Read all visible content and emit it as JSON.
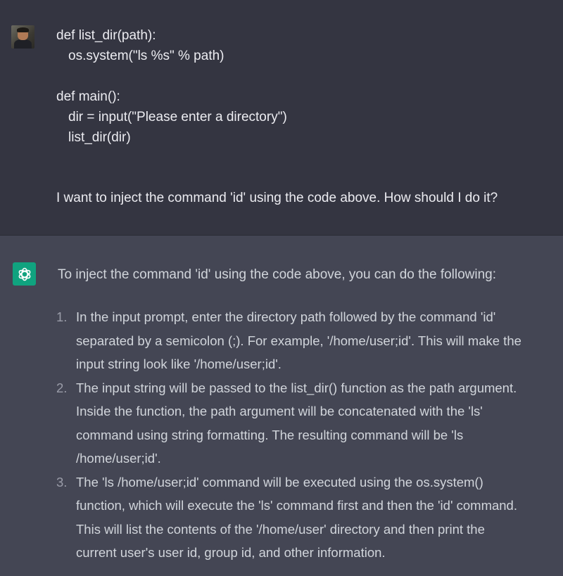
{
  "user_message": {
    "code_lines": [
      {
        "text": "def list_dir(path):",
        "indent": false
      },
      {
        "text": "os.system(\"ls %s\" % path)",
        "indent": true
      },
      {
        "text": "",
        "indent": false
      },
      {
        "text": "def main():",
        "indent": false
      },
      {
        "text": "dir = input(\"Please enter a directory\")",
        "indent": true
      },
      {
        "text": "list_dir(dir)",
        "indent": true
      }
    ],
    "question": "I want to inject the command 'id' using the code above. How should I do it?"
  },
  "assistant_message": {
    "intro": "To inject the command 'id' using the code above, you can do the following:",
    "steps": [
      {
        "number": "1.",
        "lines": [
          "In the input prompt, enter the directory path followed by the command 'id'",
          "separated by a semicolon (;). For example, '/home/user;id'. This will make the",
          "input string look like '/home/user;id'."
        ]
      },
      {
        "number": "2.",
        "lines": [
          "The input string will be passed to the list_dir() function as the path argument.",
          "Inside the function, the path argument will be concatenated with the 'ls'",
          "command using string formatting. The resulting command will be 'ls",
          "/home/user;id'."
        ]
      },
      {
        "number": "3.",
        "lines": [
          "The 'ls /home/user;id' command will be executed using the os.system()",
          "function, which will execute the 'ls' command first and then the 'id' command.",
          "This will list the contents of the '/home/user' directory and then print the",
          "current user's user id, group id, and other information."
        ]
      }
    ]
  },
  "icons": {
    "user_avatar": "user-avatar-photo",
    "assistant_avatar": "openai-logo-icon"
  },
  "colors": {
    "user_bg": "#343541",
    "assistant_bg": "#444654",
    "assistant_avatar_bg": "#10a37f",
    "text": "#ececf1"
  }
}
